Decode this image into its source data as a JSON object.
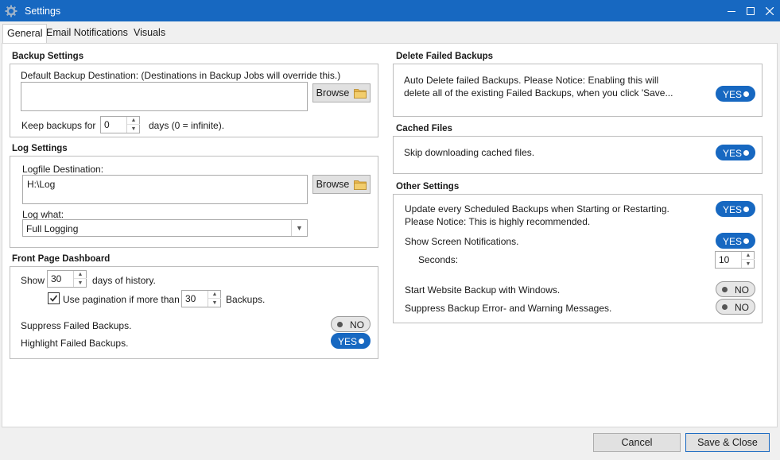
{
  "window": {
    "title": "Settings",
    "controls": [
      "minimize-icon",
      "maximize-icon",
      "close-icon"
    ]
  },
  "tabs": [
    {
      "label": "General",
      "active": true
    },
    {
      "label": "Email Notifications",
      "active": false
    },
    {
      "label": "Visuals",
      "active": false
    }
  ],
  "backup_settings": {
    "title": "Backup Settings",
    "destination_label": "Default Backup Destination: (Destinations in Backup Jobs will override this.)",
    "destination_value": "",
    "browse_label": "Browse",
    "keep_label": "Keep backups for",
    "keep_value": "0",
    "keep_suffix": "days  (0 = infinite)."
  },
  "log_settings": {
    "title": "Log Settings",
    "destination_label": "Logfile Destination:",
    "destination_value": "H:\\Log",
    "browse_label": "Browse",
    "log_what_label": "Log what:",
    "log_what_value": "Full Logging"
  },
  "dashboard": {
    "title": "Front Page Dashboard",
    "show_label": "Show",
    "show_value": "30",
    "show_suffix": "days of history.",
    "pagination_checked": true,
    "pagination_label": "Use pagination if more than",
    "pagination_value": "30",
    "pagination_suffix": "Backups.",
    "suppress_label": "Suppress Failed Backups.",
    "suppress_toggle": "NO",
    "highlight_label": "Highlight Failed Backups.",
    "highlight_toggle": "YES"
  },
  "delete_failed": {
    "title": "Delete Failed Backups",
    "line1": "Auto Delete failed Backups. Please Notice: Enabling this will",
    "line2": "delete all of the existing Failed Backups, when you click 'Save...",
    "toggle": "YES"
  },
  "cached_files": {
    "title": "Cached Files",
    "label": "Skip downloading cached files.",
    "toggle": "YES"
  },
  "other_settings": {
    "title": "Other Settings",
    "update_line1": "Update every Scheduled Backups when Starting or Restarting.",
    "update_line2": "Please Notice: This is highly recommended.",
    "update_toggle": "YES",
    "notifications_label": "Show Screen Notifications.",
    "notifications_toggle": "YES",
    "seconds_label": "Seconds:",
    "seconds_value": "10",
    "website_label": "Start Website Backup with Windows.",
    "website_toggle": "NO",
    "suppress_label": "Suppress Backup Error- and Warning Messages.",
    "suppress_toggle": "NO"
  },
  "footer": {
    "cancel_label": "Cancel",
    "save_label": "Save & Close"
  },
  "colors": {
    "accent": "#1768c1",
    "folder": "#e8b64c"
  }
}
